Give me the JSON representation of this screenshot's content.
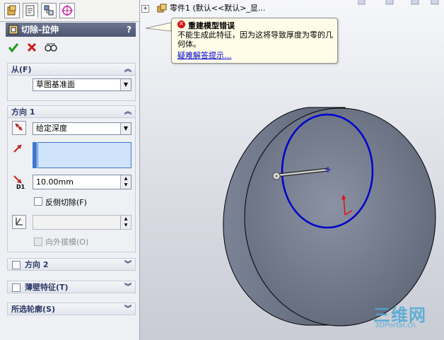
{
  "panel": {
    "title": "切除-拉伸",
    "help": "?",
    "actions": [
      "confirm-icon",
      "cancel-icon",
      "detail-preview-icon"
    ],
    "from": {
      "header": "从(F)",
      "value": "草图基准面"
    },
    "direction1": {
      "header": "方向 1",
      "end_condition": "给定深度",
      "depth_prefix": "D1",
      "depth": "10.00mm",
      "flip_side_label": "反侧切除(F)",
      "draft_outward_label": "向外拔模(O)"
    },
    "direction2": {
      "header": "方向 2"
    },
    "thin_feature": {
      "header": "薄壁特征(T)"
    },
    "selected_contours": {
      "header": "所选轮廓(S)"
    }
  },
  "tree": {
    "item": "零件1 (默认<<默认>_显..."
  },
  "error": {
    "title": "重建模型错误",
    "message": "不能生成此特征，因为这将导致厚度为零的几何体。",
    "link": "疑难解答提示..."
  },
  "watermark": {
    "cn": "三维网",
    "en": "3DPortal.cn"
  },
  "colors": {
    "title_bar": "#4d5672",
    "section_text": "#2b3966",
    "sketch_circle": "#0000cc",
    "part_body": "#6b7385",
    "error_fill": "#fffde8",
    "link": "#0000cc"
  }
}
